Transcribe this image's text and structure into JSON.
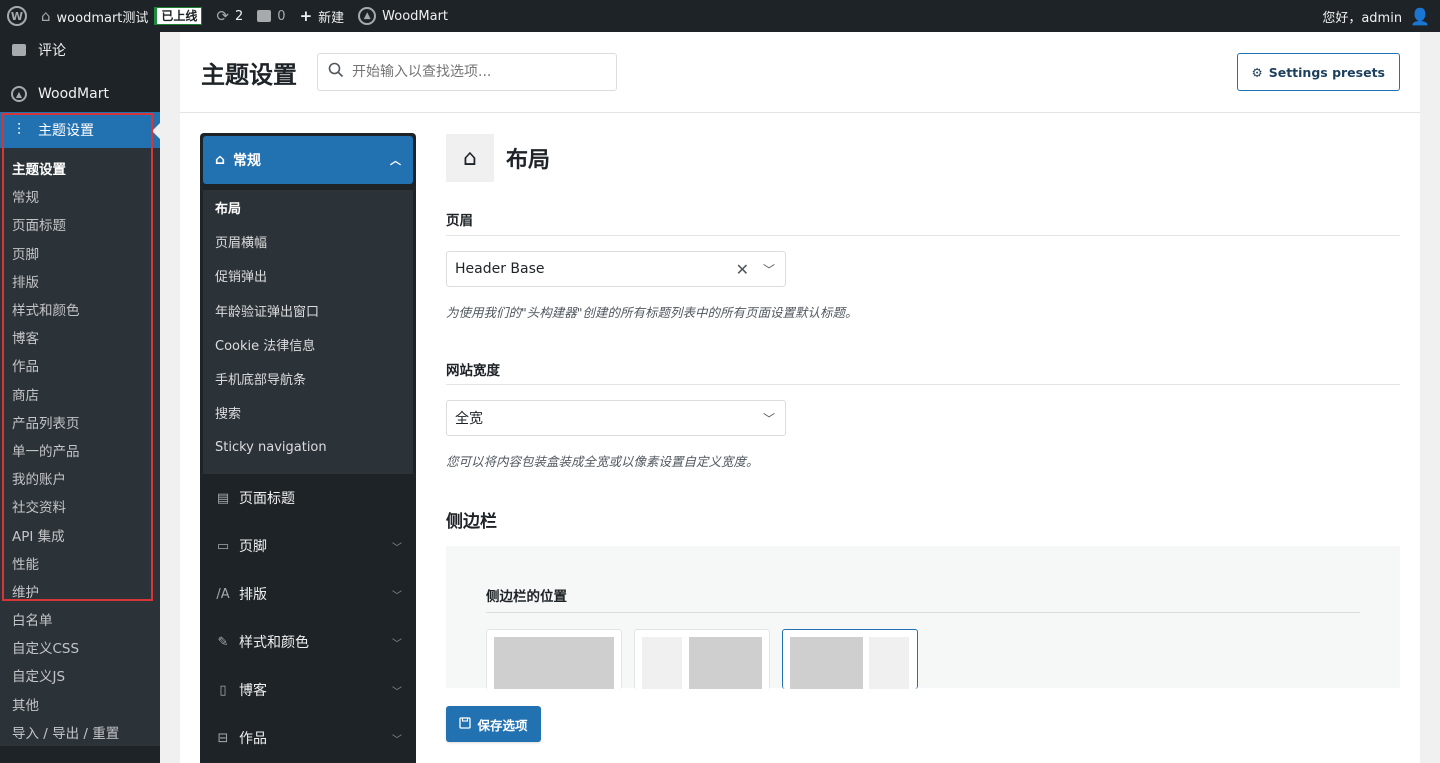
{
  "adminbar": {
    "site_name": "woodmart测试",
    "live_badge": "已上线",
    "updates_count": "2",
    "comments_count": "0",
    "new_label": "新建",
    "woodmart_label": "WoodMart",
    "greeting": "您好，admin"
  },
  "adminmenu": {
    "comments": "评论",
    "woodmart": "WoodMart",
    "theme_settings": "主题设置",
    "submenu": [
      "主题设置",
      "常规",
      "页面标题",
      "页脚",
      "排版",
      "样式和颜色",
      "博客",
      "作品",
      "商店",
      "产品列表页",
      "单一的产品",
      "我的账户",
      "社交资料",
      "API 集成",
      "性能",
      "维护",
      "白名单",
      "自定义CSS",
      "自定义JS",
      "其他",
      "导入 / 导出 / 重置"
    ]
  },
  "header": {
    "title": "主题设置",
    "search_placeholder": "开始输入以查找选项...",
    "presets_label": "Settings presets"
  },
  "options_nav": {
    "active_section": "常规",
    "active_subitems": [
      "布局",
      "页眉横幅",
      "促销弹出",
      "年龄验证弹出窗口",
      "Cookie 法律信息",
      "手机底部导航条",
      "搜索",
      "Sticky navigation"
    ],
    "sections": [
      "页面标题",
      "页脚",
      "排版",
      "样式和颜色",
      "博客",
      "作品"
    ]
  },
  "main": {
    "section_title": "布局",
    "header_label": "页眉",
    "header_value": "Header Base",
    "header_hint": "为使用我们的\"头构建器\"创建的所有标题列表中的所有页面设置默认标题。",
    "width_label": "网站宽度",
    "width_value": "全宽",
    "width_hint": "您可以将内容包装盒装成全宽或以像素设置自定义宽度。",
    "sidebar_title": "侧边栏",
    "sidebar_position_label": "侧边栏的位置",
    "save_label": "保存选项"
  }
}
